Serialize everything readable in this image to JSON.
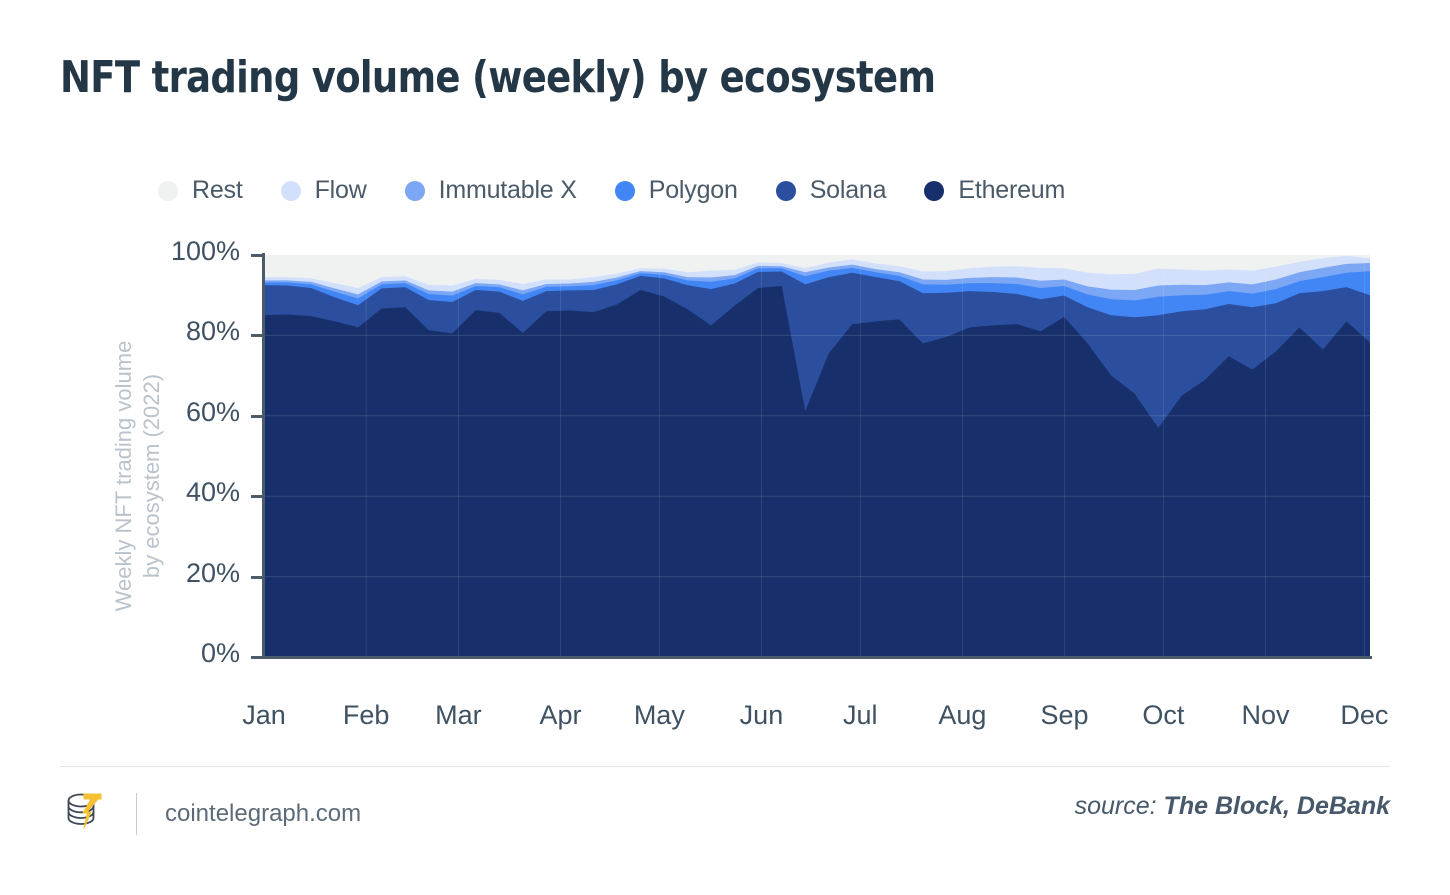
{
  "header": {
    "title": "NFT trading volume (weekly) by ecosystem"
  },
  "footer": {
    "logo_icon": "cointelegraph-coins-logo",
    "url": "cointelegraph.com",
    "source_prefix": "source: ",
    "source_names": "The Block, DeBank"
  },
  "colors": {
    "rest": "#f0f1f1",
    "flow": "#d2e0fb",
    "immutable_x": "#7ca7f4",
    "polygon": "#4286f5",
    "solana": "#2b4f9e",
    "ethereum": "#17306c",
    "axis": "#4c5b6a",
    "tick_text": "#3f5263",
    "legend_text": "#4b5a68",
    "axis_title": "#b9c3cc",
    "title_text": "#243746",
    "logo_accent": "#f5c033"
  },
  "chart_data": {
    "type": "area",
    "title": "NFT trading volume (weekly) by ecosystem",
    "xlabel": "",
    "ylabel": "Weekly NFT trading volume by ecosystem (2022)",
    "ylabel_line1": "Weekly NFT trading volume",
    "ylabel_line2": "by ecosystem (2022)",
    "stacked": true,
    "normalized_percent": true,
    "grid": true,
    "legend_position": "top",
    "ylim": [
      0,
      100
    ],
    "ytick_labels": [
      "0%",
      "20%",
      "40%",
      "60%",
      "80%",
      "100%"
    ],
    "ytick_values": [
      0,
      20,
      40,
      60,
      80,
      100
    ],
    "categories": [
      "Jan",
      "Feb",
      "Mar",
      "Apr",
      "May",
      "Jun",
      "Jul",
      "Aug",
      "Sep",
      "Oct",
      "Nov",
      "Dec"
    ],
    "x_month_positions": [
      0,
      4.34,
      8.26,
      12.6,
      16.8,
      21.14,
      25.34,
      29.68,
      34.02,
      38.22,
      42.56,
      46.76
    ],
    "n_points": 48,
    "series": [
      {
        "name": "Ethereum",
        "color": "#17306c",
        "values": [
          85.0,
          85.2,
          84.8,
          83.5,
          82.0,
          86.7,
          87.0,
          81.3,
          80.5,
          86.3,
          85.6,
          80.6,
          86.0,
          86.2,
          85.8,
          87.7,
          91.3,
          89.7,
          86.5,
          82.5,
          87.4,
          91.8,
          92.3,
          61.2,
          75.5,
          82.8,
          83.5,
          84.0,
          78.0,
          79.6,
          82.0,
          82.5,
          82.8,
          81.0,
          84.6,
          78.0,
          70.0,
          65.5,
          57.0,
          65.0,
          69.0,
          74.8,
          71.5,
          76.0,
          82.0,
          76.5,
          83.5,
          78.2
        ]
      },
      {
        "name": "Solana",
        "color": "#2b4f9e",
        "values": [
          7.5,
          7.2,
          7.0,
          6.0,
          5.5,
          5.0,
          5.0,
          7.5,
          7.8,
          5.0,
          5.3,
          8.0,
          5.0,
          5.0,
          5.5,
          5.0,
          3.5,
          4.5,
          6.0,
          9.0,
          5.5,
          4.0,
          3.6,
          31.5,
          19.0,
          12.8,
          11.0,
          9.5,
          12.5,
          11.0,
          9.0,
          8.3,
          7.5,
          8.0,
          5.3,
          9.0,
          15.0,
          19.0,
          28.0,
          21.0,
          17.5,
          13.0,
          15.5,
          12.0,
          8.5,
          14.5,
          8.5,
          11.8
        ]
      },
      {
        "name": "Polygon",
        "color": "#4286f5",
        "values": [
          0.7,
          0.8,
          0.9,
          1.4,
          1.7,
          1.0,
          1.0,
          1.5,
          1.6,
          1.0,
          1.1,
          1.6,
          1.1,
          1.0,
          1.2,
          1.0,
          0.7,
          0.9,
          1.2,
          1.8,
          1.3,
          0.9,
          0.8,
          2.0,
          1.6,
          1.2,
          1.2,
          1.3,
          2.2,
          2.0,
          2.0,
          2.2,
          2.5,
          2.8,
          2.4,
          3.2,
          4.0,
          4.2,
          4.6,
          4.0,
          3.6,
          3.2,
          3.4,
          3.5,
          3.0,
          3.5,
          3.6,
          6.0
        ]
      },
      {
        "name": "Immutable X",
        "color": "#7ca7f4",
        "values": [
          0.5,
          0.5,
          0.6,
          0.8,
          1.0,
          0.7,
          0.7,
          0.9,
          1.0,
          0.7,
          0.7,
          1.0,
          0.7,
          0.7,
          0.8,
          0.7,
          0.5,
          0.6,
          0.8,
          1.1,
          0.8,
          0.6,
          0.5,
          1.0,
          0.8,
          0.8,
          0.8,
          0.9,
          1.2,
          1.2,
          1.3,
          1.5,
          1.6,
          1.8,
          1.6,
          2.0,
          2.4,
          2.6,
          2.8,
          2.6,
          2.4,
          2.2,
          2.3,
          2.4,
          2.2,
          2.3,
          2.2,
          2.0
        ]
      },
      {
        "name": "Flow",
        "color": "#d2e0fb",
        "values": [
          0.8,
          0.8,
          0.9,
          1.3,
          1.6,
          1.1,
          1.0,
          1.4,
          1.5,
          1.1,
          1.1,
          1.6,
          1.1,
          1.0,
          1.2,
          1.0,
          0.7,
          0.9,
          1.2,
          1.7,
          1.3,
          0.9,
          0.8,
          1.0,
          1.2,
          1.3,
          1.4,
          1.5,
          2.0,
          2.2,
          2.4,
          2.6,
          2.8,
          3.2,
          2.8,
          3.4,
          3.8,
          4.0,
          4.2,
          3.8,
          3.6,
          3.2,
          3.4,
          3.2,
          2.6,
          2.4,
          2.0,
          1.2
        ]
      },
      {
        "name": "Rest",
        "color": "#f0f1f1",
        "values": [
          5.5,
          5.5,
          5.8,
          7.0,
          8.2,
          5.5,
          5.3,
          7.4,
          7.6,
          5.9,
          6.2,
          7.2,
          6.1,
          6.1,
          5.5,
          4.6,
          3.3,
          3.4,
          4.3,
          3.9,
          3.7,
          1.8,
          2.0,
          3.3,
          1.9,
          1.1,
          2.1,
          2.8,
          4.1,
          4.0,
          3.3,
          2.9,
          2.8,
          3.2,
          3.3,
          4.4,
          4.8,
          4.7,
          3.4,
          3.6,
          3.9,
          3.6,
          3.9,
          2.9,
          1.7,
          0.8,
          0.2,
          0.8
        ]
      }
    ],
    "legend": [
      {
        "label": "Rest",
        "color": "#f0f1f1"
      },
      {
        "label": "Flow",
        "color": "#d2e0fb"
      },
      {
        "label": "Immutable X",
        "color": "#7ca7f4"
      },
      {
        "label": "Polygon",
        "color": "#4286f5"
      },
      {
        "label": "Solana",
        "color": "#2b4f9e"
      },
      {
        "label": "Ethereum",
        "color": "#17306c"
      }
    ]
  }
}
